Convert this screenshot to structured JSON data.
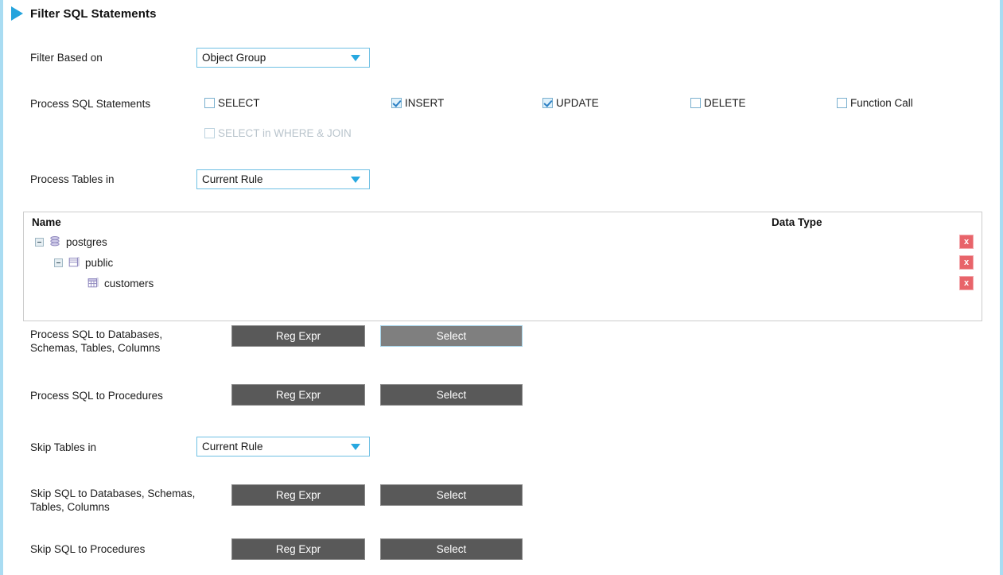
{
  "header": {
    "title": "Filter SQL Statements",
    "toggle_icon": "triangle-right-icon"
  },
  "filter_based_on": {
    "label": "Filter Based on",
    "value": "Object Group"
  },
  "process_sql_statements": {
    "label": "Process SQL Statements",
    "options": [
      {
        "label": "SELECT",
        "checked": false,
        "disabled": false
      },
      {
        "label": "INSERT",
        "checked": true,
        "disabled": false
      },
      {
        "label": "UPDATE",
        "checked": true,
        "disabled": false
      },
      {
        "label": "DELETE",
        "checked": false,
        "disabled": false
      },
      {
        "label": "Function Call",
        "checked": false,
        "disabled": false
      },
      {
        "label": "SELECT in WHERE & JOIN",
        "checked": false,
        "disabled": true
      }
    ]
  },
  "process_tables_in": {
    "label": "Process Tables in",
    "value": "Current Rule"
  },
  "object_tree": {
    "columns": {
      "name": "Name",
      "data_type": "Data Type"
    },
    "rows": [
      {
        "label": "postgres",
        "icon": "database-icon",
        "expander": "collapse-icon",
        "indent": 0,
        "data_type": "",
        "delete_label": "x"
      },
      {
        "label": "public",
        "icon": "schema-icon",
        "expander": "collapse-icon",
        "indent": 1,
        "data_type": "",
        "delete_label": "x"
      },
      {
        "label": "customers",
        "icon": "table-icon",
        "expander": "none",
        "indent": 2,
        "data_type": "",
        "delete_label": "x"
      }
    ]
  },
  "process_sql_objects": {
    "label": "Process SQL to Databases,\nSchemas, Tables, Columns",
    "reg_expr_label": "Reg Expr",
    "select_label": "Select",
    "select_focused": true
  },
  "process_sql_procedures": {
    "label": "Process SQL to Procedures",
    "reg_expr_label": "Reg Expr",
    "select_label": "Select",
    "select_focused": false
  },
  "skip_tables_in": {
    "label": "Skip Tables in",
    "value": "Current Rule"
  },
  "skip_sql_objects": {
    "label": "Skip SQL to Databases, Schemas,\nTables, Columns",
    "reg_expr_label": "Reg Expr",
    "select_label": "Select",
    "select_focused": false
  },
  "skip_sql_procedures": {
    "label": "Skip SQL to Procedures",
    "reg_expr_label": "Reg Expr",
    "select_label": "Select",
    "select_focused": false
  },
  "colors": {
    "accent_blue": "#27a8e0",
    "frame_blue": "#a9dcf2",
    "button_gray": "#595959",
    "button_gray_focused": "#7f7f7f",
    "delete_red": "#e8646a"
  }
}
